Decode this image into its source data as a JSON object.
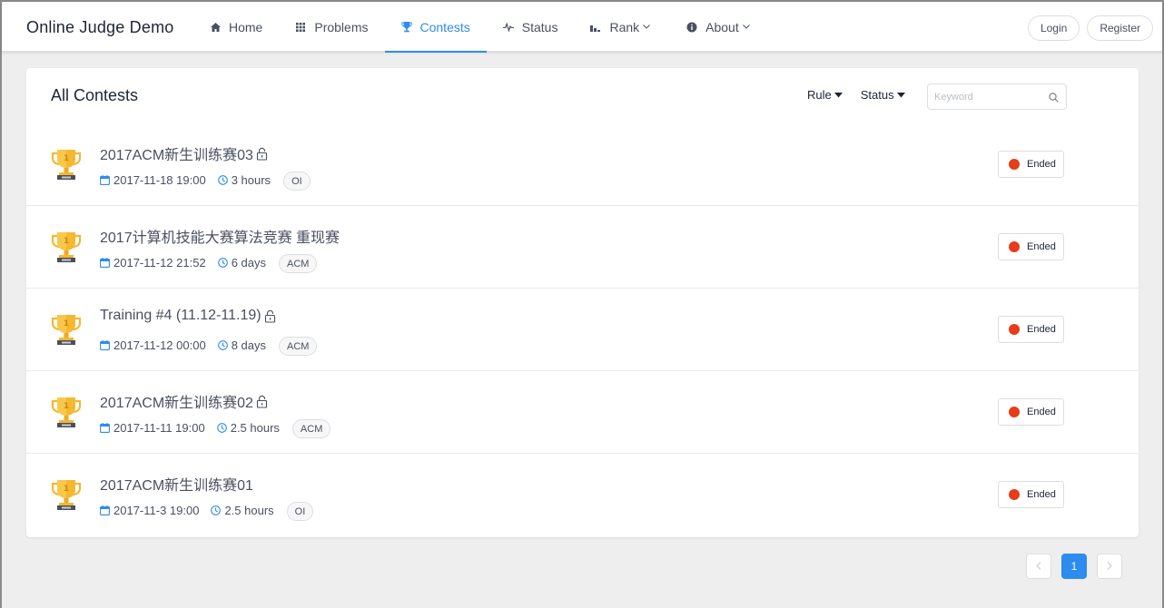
{
  "header": {
    "brand": "Online Judge Demo",
    "nav": [
      {
        "label": "Home",
        "icon": "home-icon"
      },
      {
        "label": "Problems",
        "icon": "grid-icon"
      },
      {
        "label": "Contests",
        "icon": "trophy-icon",
        "active": true
      },
      {
        "label": "Status",
        "icon": "pulse-icon"
      },
      {
        "label": "Rank",
        "icon": "bar-chart-icon",
        "dropdown": true
      },
      {
        "label": "About",
        "icon": "info-icon",
        "dropdown": true
      }
    ],
    "login_label": "Login",
    "register_label": "Register"
  },
  "contests_page": {
    "title": "All Contests",
    "rule_filter_label": "Rule",
    "status_filter_label": "Status",
    "search_placeholder": "Keyword",
    "contests": [
      {
        "title": "2017ACM新生训练赛03",
        "locked": true,
        "start": "2017-11-18 19:00",
        "duration": "3 hours",
        "rule": "OI",
        "status": "Ended"
      },
      {
        "title": "2017计算机技能大赛算法竞赛 重现赛",
        "locked": false,
        "start": "2017-11-12 21:52",
        "duration": "6 days",
        "rule": "ACM",
        "status": "Ended"
      },
      {
        "title": "Training #4 (11.12-11.19)",
        "locked": true,
        "start": "2017-11-12 00:00",
        "duration": "8 days",
        "rule": "ACM",
        "status": "Ended"
      },
      {
        "title": "2017ACM新生训练赛02",
        "locked": true,
        "start": "2017-11-11 19:00",
        "duration": "2.5 hours",
        "rule": "ACM",
        "status": "Ended"
      },
      {
        "title": "2017ACM新生训练赛01",
        "locked": false,
        "start": "2017-11-3 19:00",
        "duration": "2.5 hours",
        "rule": "OI",
        "status": "Ended"
      }
    ]
  },
  "pagination": {
    "current_page": "1",
    "prev_icon": "chevron-left-icon",
    "next_icon": "chevron-right-icon"
  },
  "colors": {
    "accent": "#2d8cf0",
    "ended_dot": "#e63c1a",
    "trophy_gold": "#f5b82e"
  }
}
